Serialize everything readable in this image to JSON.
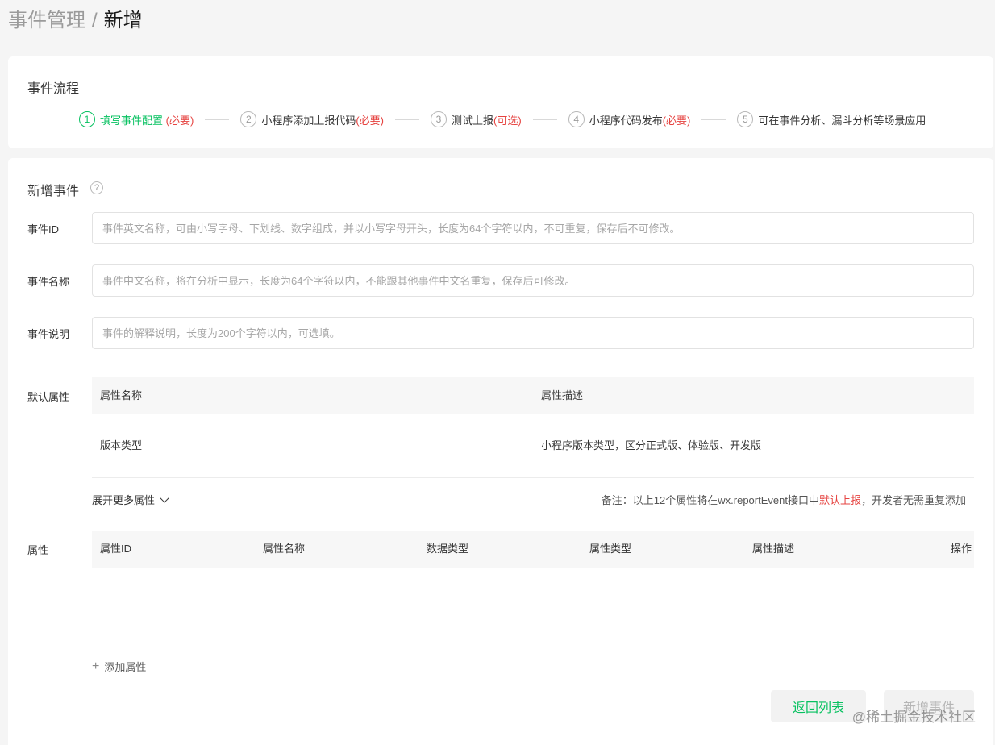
{
  "breadcrumb": {
    "parent": "事件管理",
    "separator": "/",
    "current": "新增"
  },
  "flow": {
    "title": "事件流程",
    "steps": [
      {
        "num": "1",
        "label": "填写事件配置",
        "tag": "(必要)"
      },
      {
        "num": "2",
        "label": "小程序添加上报代码",
        "tag": "(必要)"
      },
      {
        "num": "3",
        "label": "测试上报",
        "tag": "(可选)"
      },
      {
        "num": "4",
        "label": "小程序代码发布",
        "tag": "(必要)"
      },
      {
        "num": "5",
        "label": "可在事件分析、漏斗分析等场景应用",
        "tag": ""
      }
    ]
  },
  "form": {
    "title": "新增事件",
    "help_icon": "?",
    "event_id": {
      "label": "事件ID",
      "placeholder": "事件英文名称，可由小写字母、下划线、数字组成，并以小写字母开头，长度为64个字符以内，不可重复，保存后不可修改。"
    },
    "event_name": {
      "label": "事件名称",
      "placeholder": "事件中文名称，将在分析中显示，长度为64个字符以内，不能跟其他事件中文名重复，保存后可修改。"
    },
    "event_desc": {
      "label": "事件说明",
      "placeholder": "事件的解释说明，长度为200个字符以内，可选填。"
    }
  },
  "default_attrs": {
    "label": "默认属性",
    "columns": [
      "属性名称",
      "属性描述"
    ],
    "rows": [
      {
        "name": "版本类型",
        "desc": "小程序版本类型，区分正式版、体验版、开发版"
      }
    ],
    "expand_label": "展开更多属性",
    "note_prefix": "备注：以上12个属性将在wx.reportEvent接口中",
    "note_highlight": "默认上报",
    "note_suffix": "，开发者无需重复添加"
  },
  "attrs": {
    "label": "属性",
    "columns": [
      "属性ID",
      "属性名称",
      "数据类型",
      "属性类型",
      "属性描述",
      "操作"
    ],
    "add_label": "添加属性"
  },
  "buttons": {
    "back": "返回列表",
    "add": "新增事件"
  },
  "watermark": "@稀土掘金技术社区",
  "colors": {
    "accent": "#07c160",
    "required": "#e64340"
  }
}
